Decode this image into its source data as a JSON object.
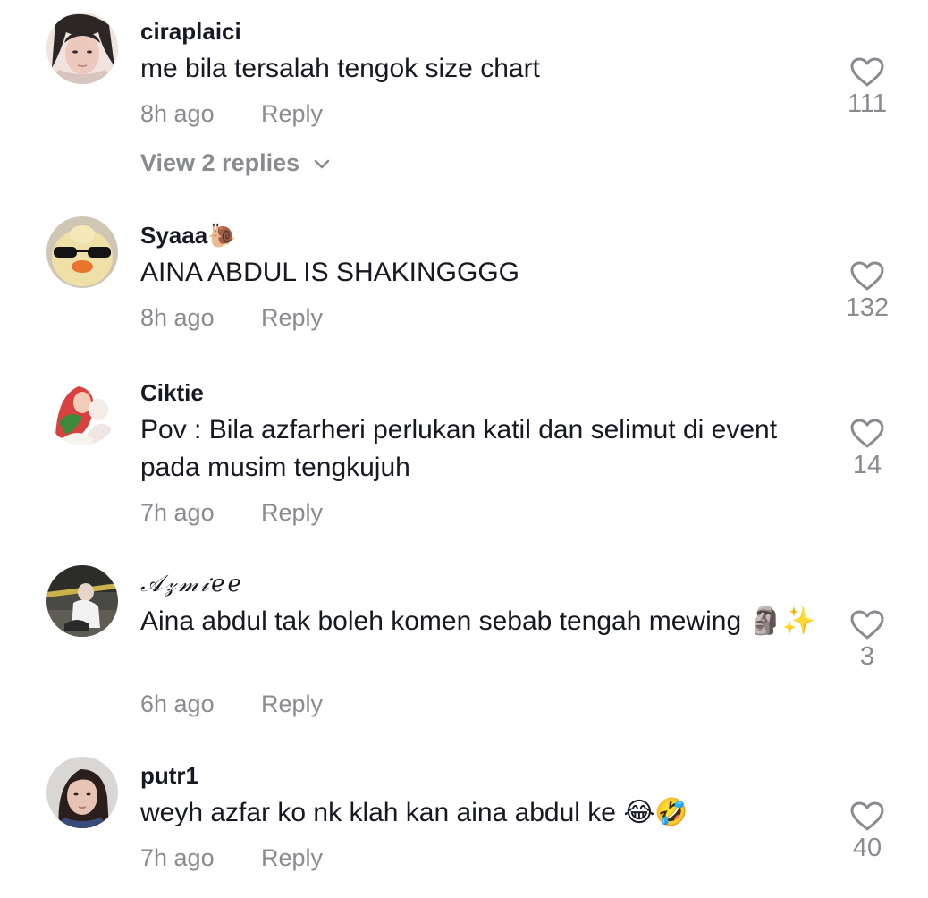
{
  "comments": [
    {
      "username": "ciraplaici",
      "text": "me bila tersalah tengok size chart",
      "time": "8h ago",
      "reply": "Reply",
      "likes": "111",
      "view_replies": "View 2 replies"
    },
    {
      "username": "Syaaa🐌",
      "text": "AINA ABDUL IS SHAKINGGGG",
      "time": "8h ago",
      "reply": "Reply",
      "likes": "132"
    },
    {
      "username": "Ciktie",
      "text": "Pov : Bila azfarheri perlukan katil dan selimut di event pada musim tengkujuh",
      "time": "7h ago",
      "reply": "Reply",
      "likes": "14"
    },
    {
      "username": "𝒜𝓏𝓂𝒾𝑒𝑒",
      "text": "Aina abdul tak boleh komen sebab tengah mewing 🗿✨",
      "time": "6h ago",
      "reply": "Reply",
      "likes": "3"
    },
    {
      "username": "putr1",
      "text": "weyh azfar ko nk klah kan aina abdul ke 😂🤣",
      "time": "7h ago",
      "reply": "Reply",
      "likes": "40"
    }
  ],
  "colors": {
    "text": "#161823",
    "secondary": "#8a8b91",
    "background": "#ffffff"
  },
  "icons": {
    "like": "heart-outline-icon",
    "expand": "chevron-down-icon"
  }
}
